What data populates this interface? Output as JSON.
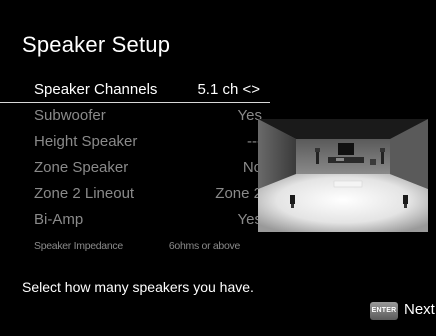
{
  "screen": {
    "title": "Speaker Setup"
  },
  "menu": [
    {
      "label": "Speaker Channels",
      "value": "5.1 ch <>",
      "selected": true
    },
    {
      "label": "Subwoofer",
      "value": "Yes"
    },
    {
      "label": "Height Speaker",
      "value": "---"
    },
    {
      "label": "Zone Speaker",
      "value": "No"
    },
    {
      "label": "Zone 2 Lineout",
      "value": "Zone 2"
    },
    {
      "label": "Bi-Amp",
      "value": "Yes"
    },
    {
      "label": "Speaker Impedance",
      "value": "6ohms or above"
    }
  ],
  "hint": "Select how many speakers you have.",
  "footer": {
    "enter_key_label": "ENTER",
    "next_label": "Next"
  },
  "colors": {
    "background": "#000000",
    "active_text": "#ffffff",
    "inactive_text": "#8a8a8a"
  },
  "icons": {
    "enter": "enter-key-icon",
    "preview": "speaker-room-diagram"
  }
}
